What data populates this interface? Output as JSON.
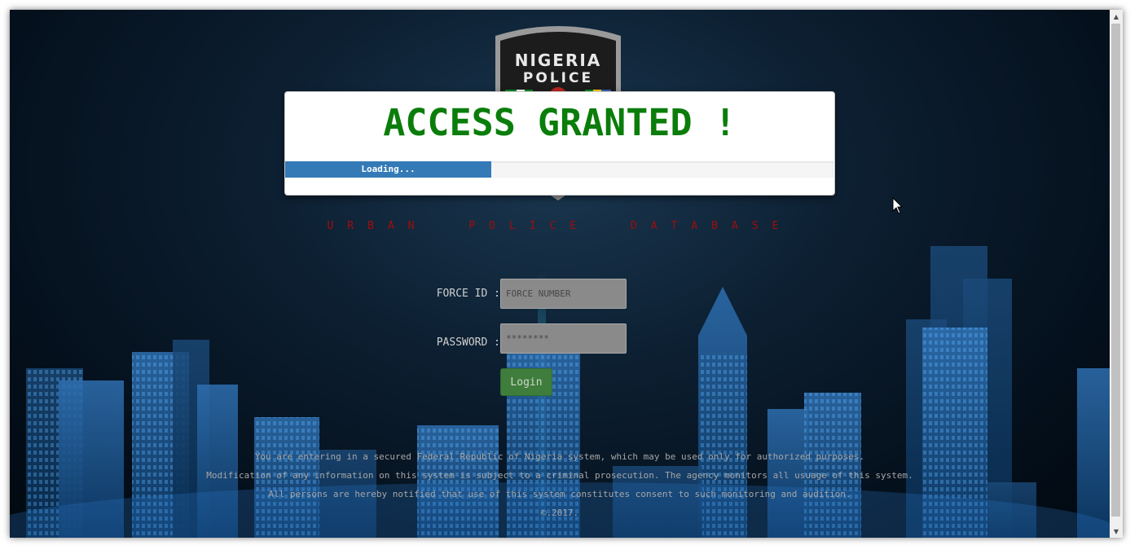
{
  "logo": {
    "badge_text_top": "NIGERIA",
    "badge_text_bottom": "POLICE"
  },
  "tagline": "URBAN POLICE DATABASE",
  "form": {
    "force_id_label": "FORCE ID :",
    "force_id_placeholder": "FORCE NUMBER",
    "password_label": "PASSWORD :",
    "password_placeholder": "********",
    "login_label": "Login"
  },
  "disclaimer": {
    "line1": "You are entering in a secured Federal Republic of Nigeria system, which may be used only for authorized purposes.",
    "line2": "Modification of any information on this system is subject to a criminal prosecution. The agency monitors all usuage of this system.",
    "line3": "All persons are hereby notified that use of this system constitutes consent to such monitoring and audition.",
    "copyright": "©.2017."
  },
  "modal": {
    "title": "ACCESS GRANTED !",
    "progress_label": "Loading...",
    "progress_percent": 37.6
  },
  "colors": {
    "title_green": "#0a7d0a",
    "progress_blue": "#337ab7",
    "tagline_red": "#a00d0d",
    "login_green": "#3e7d3b"
  },
  "icons": {
    "cursor": "mouse-pointer-icon",
    "scroll_up": "scroll-up-arrow-icon",
    "scroll_down": "scroll-down-arrow-icon"
  }
}
